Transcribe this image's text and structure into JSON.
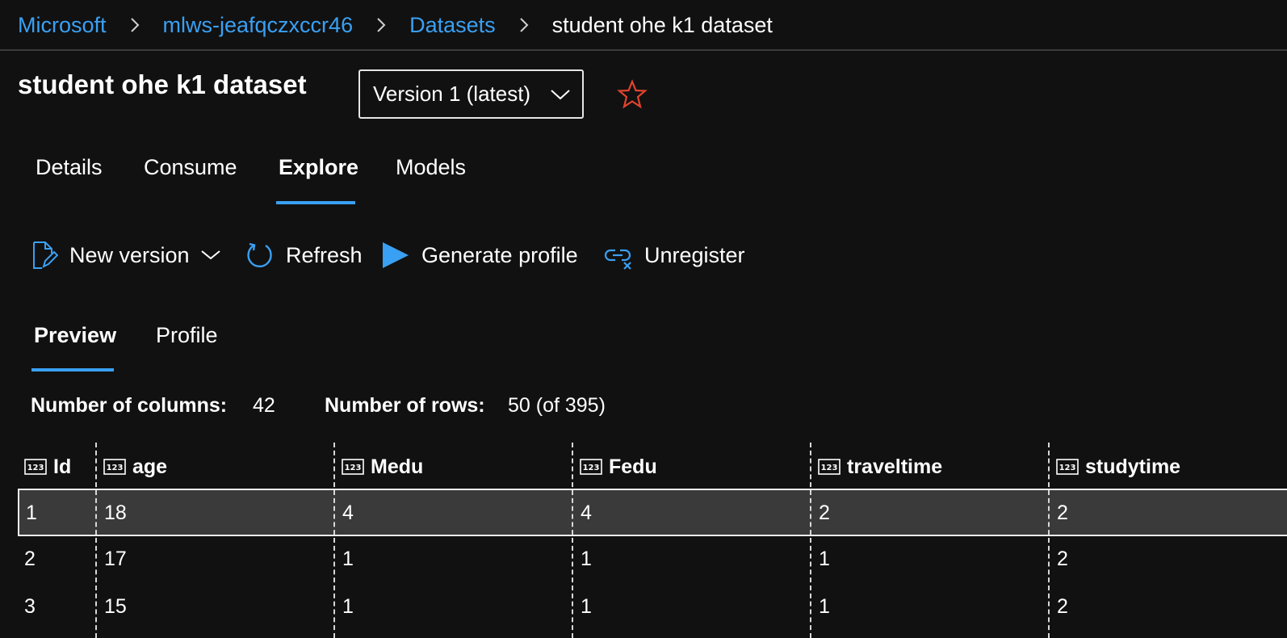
{
  "breadcrumb": {
    "items": [
      "Microsoft",
      "mlws-jeafqczxccr46",
      "Datasets"
    ],
    "current": "student ohe k1 dataset"
  },
  "page": {
    "title": "student ohe k1 dataset",
    "version_selected": "Version 1 (latest)",
    "favorite_icon": "star-outline-icon",
    "accent_color": "#3aa0f3",
    "favorite_color": "#e0432f"
  },
  "tabs": {
    "items": [
      "Details",
      "Consume",
      "Explore",
      "Models"
    ],
    "active": "Explore"
  },
  "toolbar": {
    "new_version": "New version",
    "refresh": "Refresh",
    "generate_profile": "Generate profile",
    "unregister": "Unregister"
  },
  "subtabs": {
    "items": [
      "Preview",
      "Profile"
    ],
    "active": "Preview"
  },
  "stats": {
    "columns_label": "Number of columns:",
    "columns_value": "42",
    "rows_label": "Number of rows:",
    "rows_value": "50 (of 395)"
  },
  "table": {
    "type_icon": "numeric-123-icon",
    "columns": [
      "Id",
      "age",
      "Medu",
      "Fedu",
      "traveltime",
      "studytime"
    ],
    "rows": [
      [
        "1",
        "18",
        "4",
        "4",
        "2",
        "2"
      ],
      [
        "2",
        "17",
        "1",
        "1",
        "1",
        "2"
      ],
      [
        "3",
        "15",
        "1",
        "1",
        "1",
        "2"
      ]
    ],
    "selected_row": 0
  }
}
